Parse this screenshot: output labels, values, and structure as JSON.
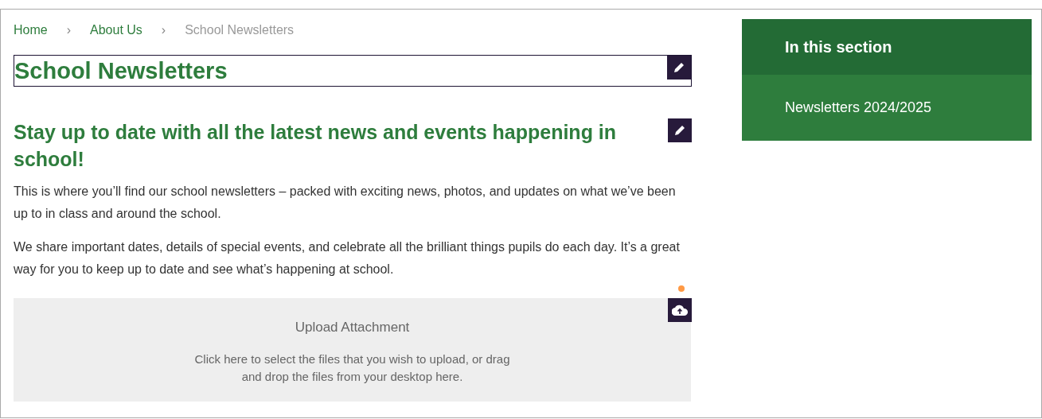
{
  "breadcrumb": [
    {
      "label": "Home",
      "current": false
    },
    {
      "label": "About Us",
      "current": false
    },
    {
      "label": "School Newsletters",
      "current": true
    }
  ],
  "separator": "›",
  "title": "School Newsletters",
  "subtitle": "Stay up to date with all the latest news and events happening in school!",
  "paragraphs": [
    "This is where you’ll find our school newsletters – packed with exciting news, photos, and updates on what we’ve been up to in class and around the school.",
    "We share important dates, details of special events, and celebrate all the brilliant things pupils do each day. It’s a great way for you to keep up to date and see what’s happening at school."
  ],
  "upload": {
    "title": "Upload Attachment",
    "hint": "Click here to select the files that you wish to upload, or drag and drop the files from your desktop here."
  },
  "sidebar": {
    "title": "In this section",
    "items": [
      "Newsletters 2024/2025"
    ]
  }
}
